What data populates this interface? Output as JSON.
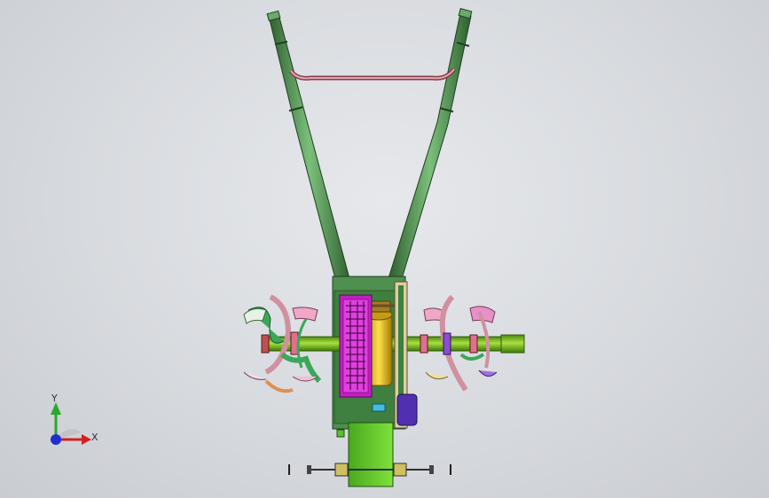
{
  "viewport": {
    "model": "rotary-tiller-assembly",
    "background": "#d9dce0"
  },
  "triad": {
    "x_label": "X",
    "y_label": "Y",
    "x_color": "#d42020",
    "y_color": "#2aa82a",
    "z_color": "#2030d0"
  },
  "colors": {
    "handle": "#5f9a5f",
    "handle_dark": "#2f5f2f",
    "crossbar": "#d49aa2",
    "frame": "#4f8f4f",
    "gearbox": "#cc22cc",
    "pulley": "#e8c020",
    "shaft": "#7ac020",
    "motor": "#6bd02e",
    "blade_pink": "#e89ab0",
    "blade_green": "#3aa85a",
    "blade_purple": "#8040c8"
  }
}
